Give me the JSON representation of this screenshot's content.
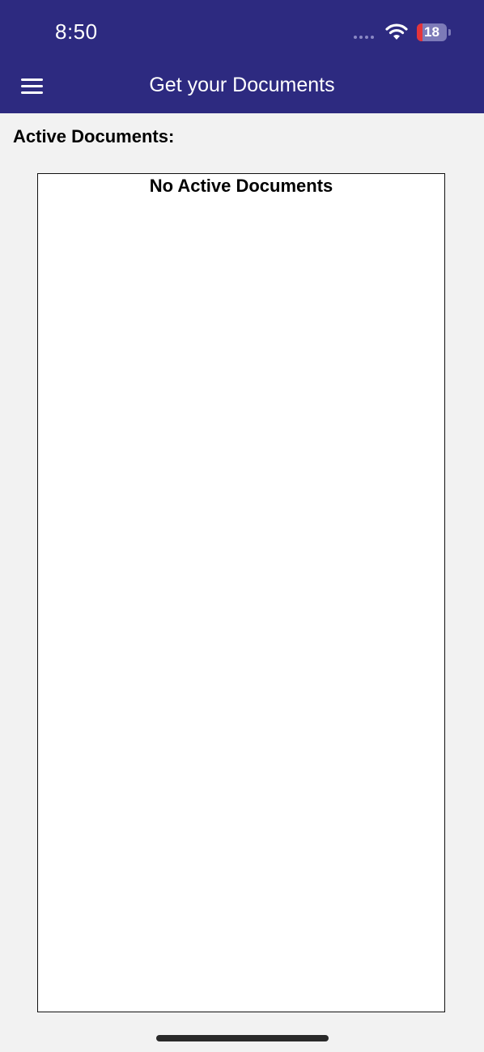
{
  "status_bar": {
    "time": "8:50",
    "battery_level": "18",
    "battery_fraction": 0.18
  },
  "header": {
    "title": "Get your Documents",
    "menu_icon": "hamburger-menu-icon"
  },
  "main": {
    "section_heading": "Active Documents:",
    "empty_message": "No Active Documents"
  },
  "colors": {
    "header_background": "#2d2a80",
    "page_background": "#f2f2f2",
    "battery_low": "#e5343a"
  }
}
